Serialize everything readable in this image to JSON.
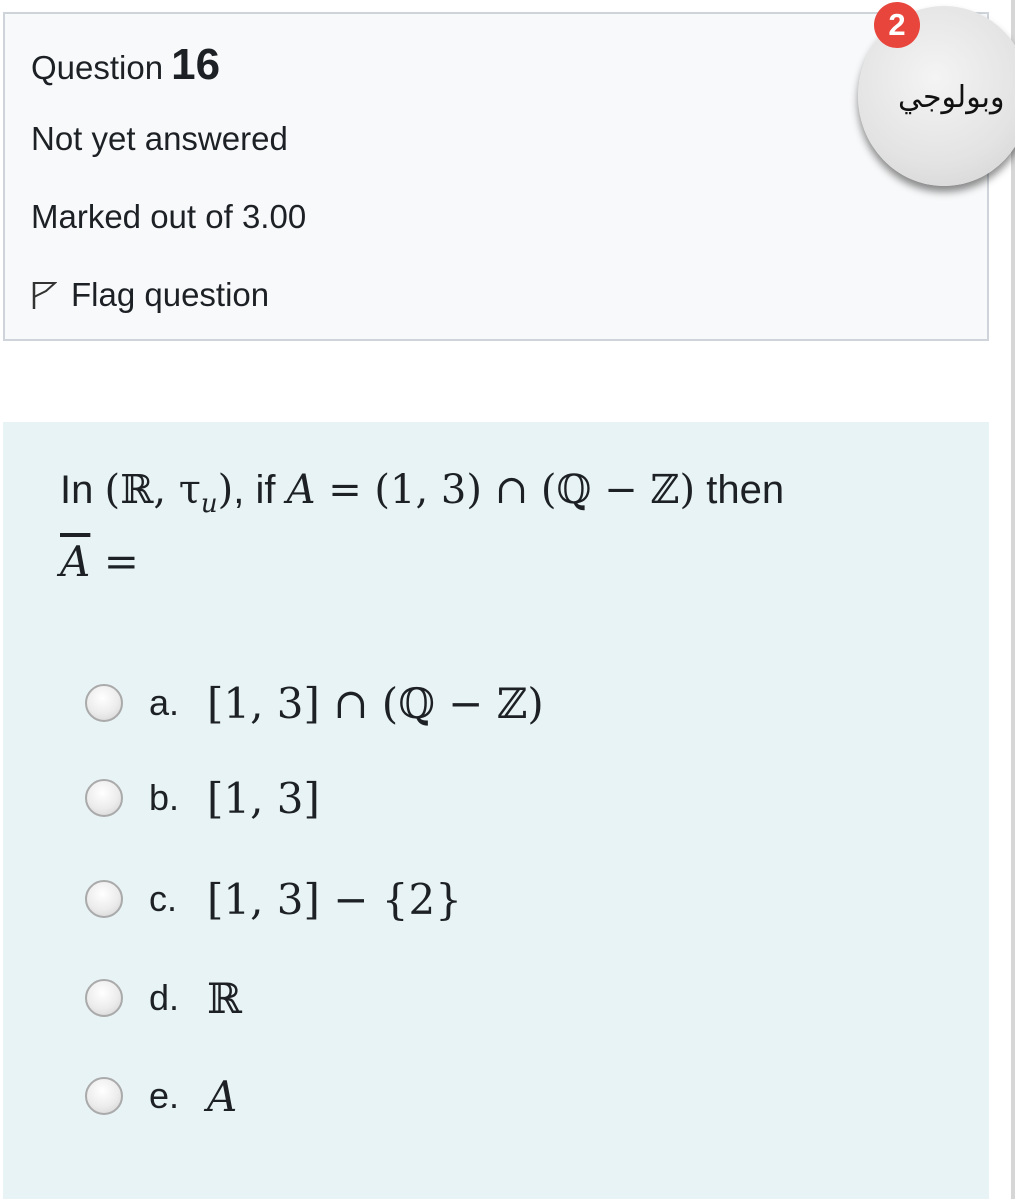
{
  "info": {
    "question_label": "Question",
    "question_number": "16",
    "state": "Not yet answered",
    "grade": "Marked out of 3.00",
    "flag_label": "Flag question"
  },
  "badge": {
    "count": "2",
    "color": "#e8453c"
  },
  "avatar": {
    "text": "وبولوجي"
  },
  "question": {
    "line1": {
      "in": "In ",
      "space": "(ℝ, τ",
      "sub": "u",
      "close": ")",
      "if": ", if ",
      "var": "A",
      "expr": " = (1, 3) ∩ (ℚ − ℤ)",
      "then": " then"
    },
    "line2": {
      "var": "A",
      "eq": " ="
    }
  },
  "options": [
    {
      "letter": "a.",
      "answer": "[1, 3] ∩ (ℚ − ℤ)"
    },
    {
      "letter": "b.",
      "answer": "[1, 3]"
    },
    {
      "letter": "c.",
      "answer": "[1, 3] − {2}"
    },
    {
      "letter": "d.",
      "answer": "ℝ"
    },
    {
      "letter": "e.",
      "answer": "A"
    }
  ],
  "colors": {
    "info_bg": "#f8f9fa",
    "content_bg": "#e7f3f5",
    "border": "#ced4da"
  }
}
